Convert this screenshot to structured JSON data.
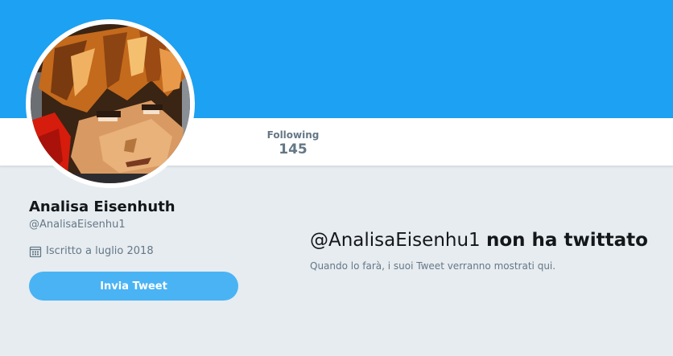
{
  "profile": {
    "name": "Analisa Eisenhuth",
    "handle": "@AnalisaEisenhu1",
    "joined": "Iscritto a luglio 2018",
    "joined_icon": "calendar-icon"
  },
  "stats": {
    "following_label": "Following",
    "following_count": "145"
  },
  "actions": {
    "tweet_button_label": "Invia Tweet"
  },
  "empty_state": {
    "handle": "@AnalisaEisenhu1",
    "title_suffix": "non ha twittato",
    "subtitle": "Quando lo farà, i suoi Tweet verranno mostrati qui."
  },
  "colors": {
    "banner": "#1da1f2",
    "page_background": "#e6ecf0",
    "button": "#4ab3f4",
    "secondary_text": "#657786",
    "primary_text": "#14171a"
  }
}
